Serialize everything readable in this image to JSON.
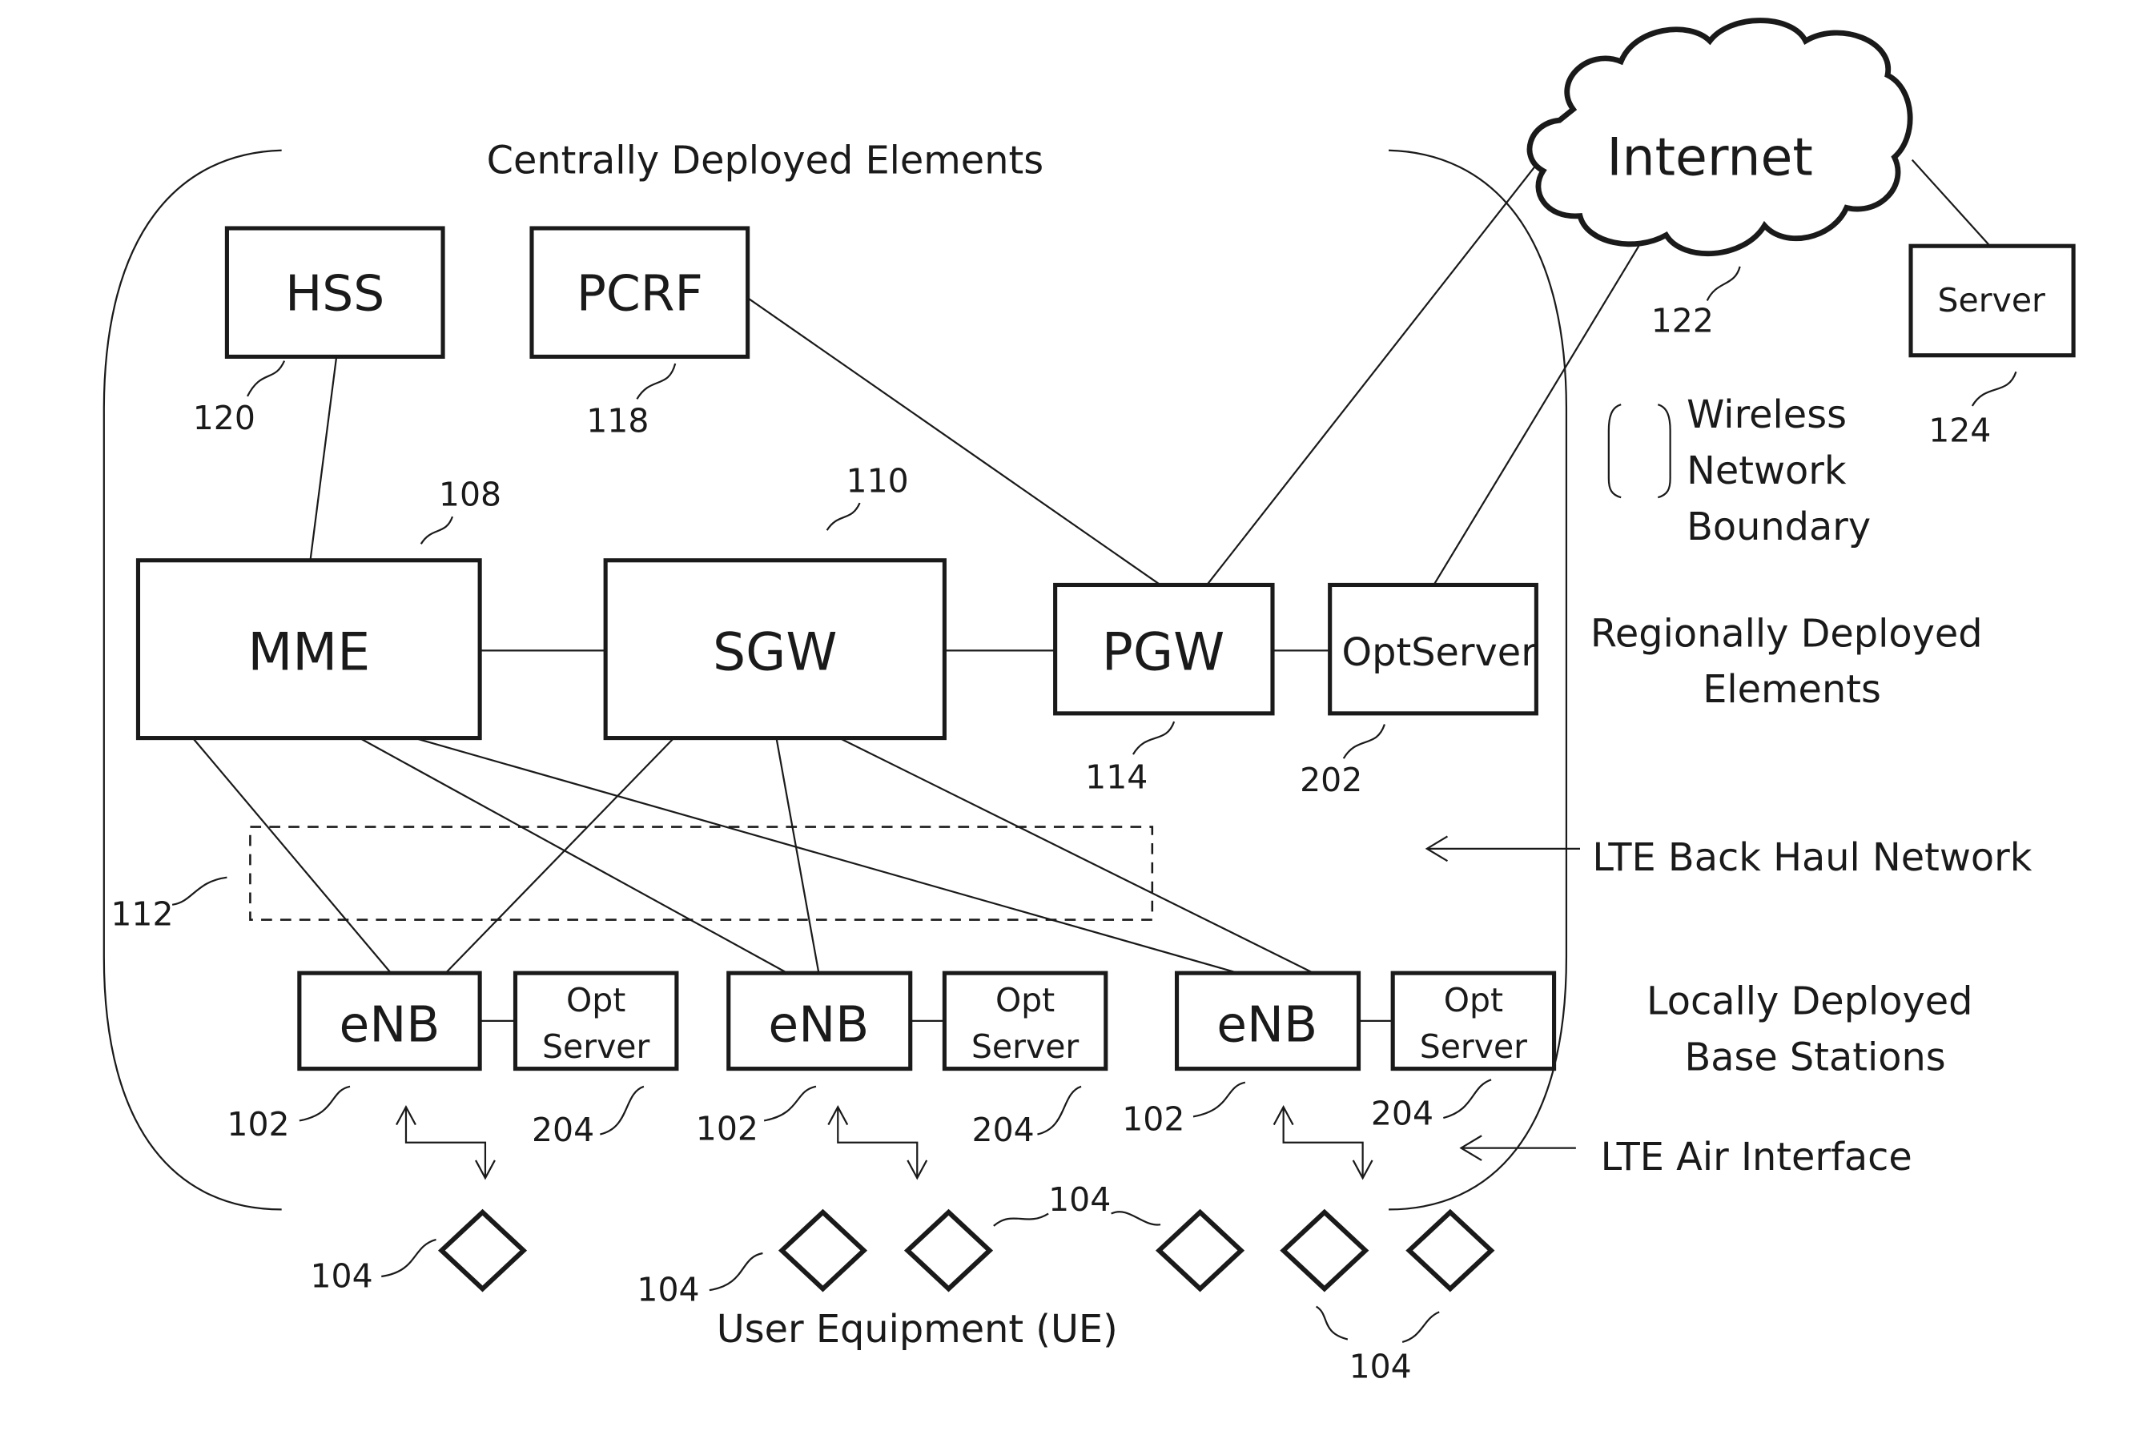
{
  "diagram": {
    "regions": {
      "central": "Centrally Deployed Elements",
      "regional_line1": "Regionally Deployed",
      "regional_line2": "Elements",
      "local_line1": "Locally Deployed",
      "local_line2": "Base Stations",
      "backhaul": "LTE Back Haul Network",
      "air": "LTE Air Interface",
      "ue": "User Equipment (UE)"
    },
    "legend": {
      "line1": "Wireless",
      "line2": "Network",
      "line3": "Boundary"
    },
    "nodes": {
      "hss": {
        "label": "HSS",
        "ref": "120"
      },
      "pcrf": {
        "label": "PCRF",
        "ref": "118"
      },
      "mme": {
        "label": "MME",
        "ref": "108"
      },
      "sgw": {
        "label": "SGW",
        "ref": "110"
      },
      "pgw": {
        "label": "PGW",
        "ref": "114"
      },
      "optserver": {
        "label": "OptServer",
        "ref": "202"
      },
      "internet": {
        "label": "Internet",
        "ref": "122"
      },
      "server": {
        "label": "Server",
        "ref": "124"
      },
      "backhaul_box": {
        "ref": "112"
      },
      "enb": [
        {
          "label": "eNB",
          "ref": "102"
        },
        {
          "label": "eNB",
          "ref": "102"
        },
        {
          "label": "eNB",
          "ref": "102"
        }
      ],
      "opt_local": [
        {
          "line1": "Opt",
          "line2": "Server",
          "ref": "204"
        },
        {
          "line1": "Opt",
          "line2": "Server",
          "ref": "204"
        },
        {
          "line1": "Opt",
          "line2": "Server",
          "ref": "204"
        }
      ],
      "ue_refs": [
        "104",
        "104",
        "104",
        "104"
      ]
    }
  }
}
